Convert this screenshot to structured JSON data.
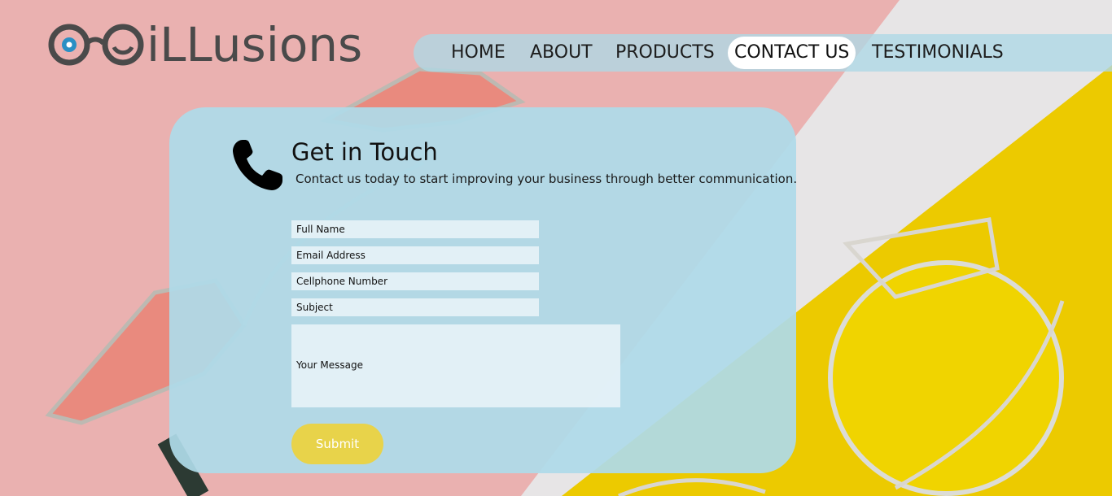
{
  "brand": {
    "name": "iLLusions",
    "logo_icon": "glasses-logo-icon"
  },
  "nav": {
    "items": [
      {
        "label": "HOME",
        "active": false
      },
      {
        "label": "ABOUT",
        "active": false
      },
      {
        "label": "PRODUCTS",
        "active": false
      },
      {
        "label": "CONTACT US",
        "active": true
      },
      {
        "label": "TESTIMONIALS",
        "active": false
      }
    ]
  },
  "contact": {
    "icon": "phone-icon",
    "title": "Get in Touch",
    "subtitle": "Contact us today to start improving your business through better communication.",
    "fields": {
      "full_name": {
        "placeholder": "Full Name",
        "value": ""
      },
      "email": {
        "placeholder": "Email Address",
        "value": ""
      },
      "cellphone": {
        "placeholder": "Cellphone Number",
        "value": ""
      },
      "subject": {
        "placeholder": "Subject",
        "value": ""
      },
      "message": {
        "placeholder": "Your Message",
        "value": ""
      }
    },
    "submit_label": "Submit"
  },
  "colors": {
    "nav_bar": "#add8e6",
    "card": "#aedae8",
    "submit_button": "#e8d34a",
    "logo_text": "#4a4a4a",
    "logo_accent": "#2a8fc4",
    "background_pink": "#eab1b0",
    "background_yellow": "#ecca00"
  }
}
